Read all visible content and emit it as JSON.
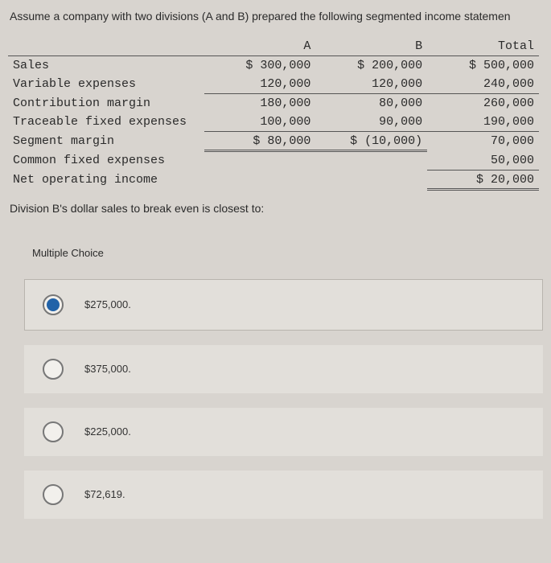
{
  "intro": "Assume a company with two divisions (A and B) prepared the following segmented income statemen",
  "headers": {
    "a": "A",
    "b": "B",
    "total": "Total"
  },
  "rows": {
    "sales": {
      "label": "Sales",
      "a": "$ 300,000",
      "b": "$ 200,000",
      "t": "$ 500,000"
    },
    "varexp": {
      "label": "Variable expenses",
      "a": "120,000",
      "b": "120,000",
      "t": "240,000"
    },
    "contrib": {
      "label": "Contribution margin",
      "a": "180,000",
      "b": "80,000",
      "t": "260,000"
    },
    "tracefx": {
      "label": "Traceable fixed expenses",
      "a": "100,000",
      "b": "90,000",
      "t": "190,000"
    },
    "segmarg": {
      "label": "Segment margin",
      "a": "$ 80,000",
      "b": "$ (10,000)",
      "t": "70,000"
    },
    "commonfx": {
      "label": "Common fixed expenses",
      "a": "",
      "b": "",
      "t": "50,000"
    },
    "noi": {
      "label": "Net operating income",
      "a": "",
      "b": "",
      "t": "$ 20,000"
    }
  },
  "question": "Division B's dollar sales to break even is closest to:",
  "mc_label": "Multiple Choice",
  "options": {
    "o1": "$275,000.",
    "o2": "$375,000.",
    "o3": "$225,000.",
    "o4": "$72,619."
  },
  "selected": "o1"
}
